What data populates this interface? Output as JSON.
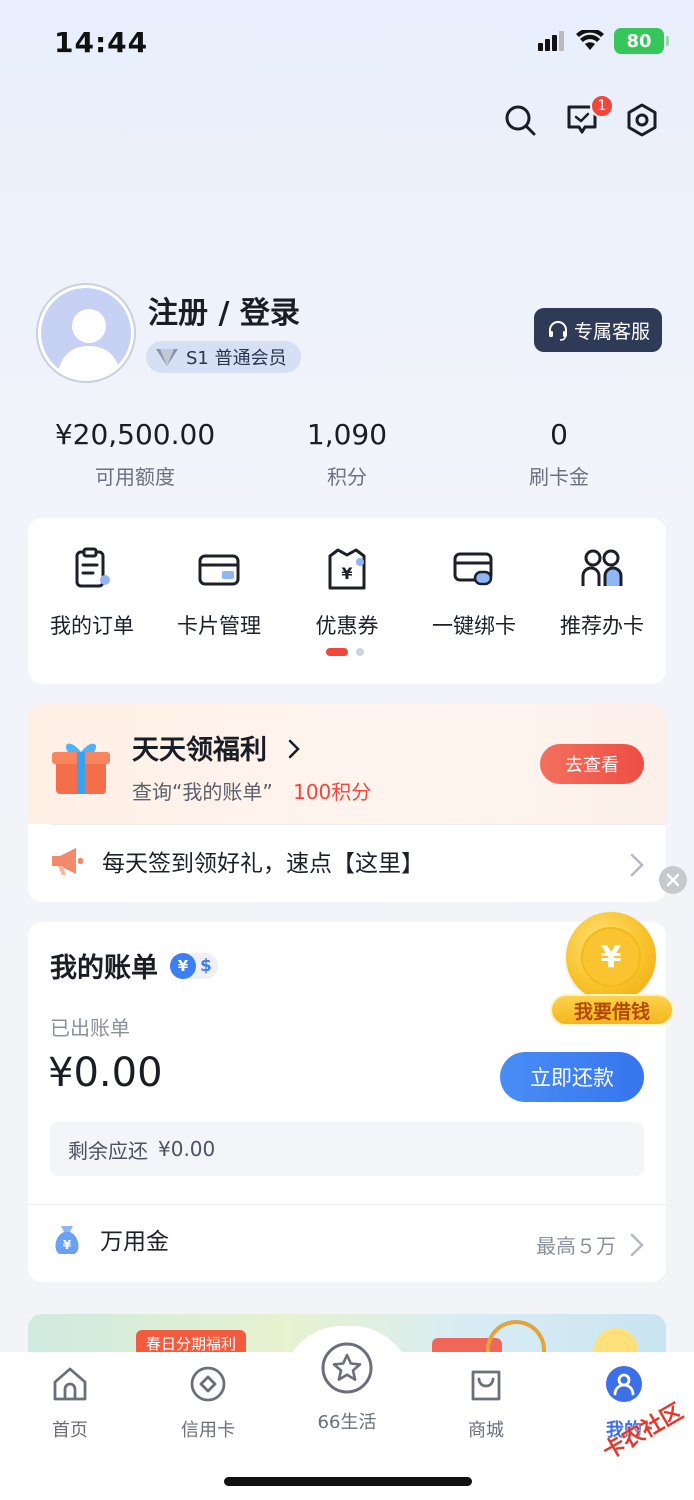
{
  "status_bar": {
    "time": "14:44",
    "battery": "80"
  },
  "header": {
    "message_badge": "1"
  },
  "profile": {
    "title": "注册 / 登录",
    "member_level": "S1 普通会员",
    "service_button": "专属客服"
  },
  "stats": [
    {
      "value": "¥20,500.00",
      "label": "可用额度"
    },
    {
      "value": "1,090",
      "label": "积分"
    },
    {
      "value": "0",
      "label": "刷卡金"
    }
  ],
  "quick_actions": [
    {
      "label": "我的订单",
      "icon": "order-icon"
    },
    {
      "label": "卡片管理",
      "icon": "card-icon"
    },
    {
      "label": "优惠券",
      "icon": "coupon-icon"
    },
    {
      "label": "一键绑卡",
      "icon": "bind-card-icon"
    },
    {
      "label": "推荐办卡",
      "icon": "recommend-icon"
    }
  ],
  "welfare": {
    "title": "天天领福利",
    "subtitle_prefix": "查询“我的账单”",
    "subtitle_highlight": "100积分",
    "button": "去查看",
    "notice": "每天签到领好礼，速点【这里】"
  },
  "bill": {
    "title": "我的账单",
    "currency_cny": "¥",
    "currency_usd": "$",
    "status_label": "已出账单",
    "amount": "¥0.00",
    "repay_button": "立即还款",
    "remaining_label": "剩余应还",
    "remaining_value": "¥0.00",
    "product_name": "万用金",
    "product_limit": "最高５万"
  },
  "floating": {
    "loan_label": "我要借钱",
    "coin_symbol": "¥"
  },
  "banner": {
    "tag": "春日分期福利"
  },
  "tabbar": [
    {
      "label": "首页",
      "icon": "home-icon"
    },
    {
      "label": "信用卡",
      "icon": "credit-card-icon"
    },
    {
      "label": "66生活",
      "icon": "star-icon"
    },
    {
      "label": "商城",
      "icon": "shopping-bag-icon"
    },
    {
      "label": "我的",
      "icon": "profile-icon",
      "active": true
    }
  ],
  "watermark": "卡农社区",
  "colors": {
    "accent_blue": "#3d7ef0",
    "accent_red": "#f0463c",
    "dark_button": "#2f3a56"
  }
}
